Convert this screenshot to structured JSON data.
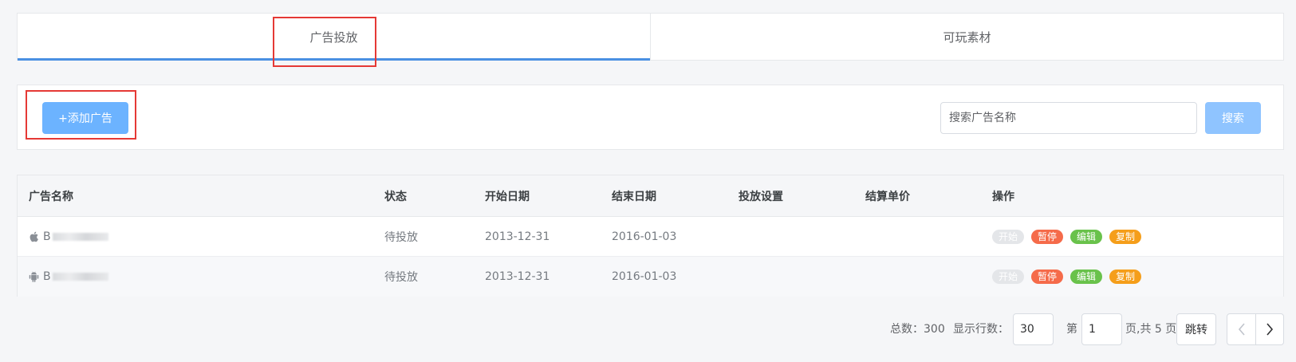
{
  "tabs": [
    {
      "label": "广告投放",
      "active": true
    },
    {
      "label": "可玩素材",
      "active": false
    }
  ],
  "toolbar": {
    "add_label": "+添加广告",
    "search_placeholder": "搜索广告名称",
    "search_label": "搜索"
  },
  "table": {
    "headers": {
      "name": "广告名称",
      "status": "状态",
      "start": "开始日期",
      "end": "结束日期",
      "setting": "投放设置",
      "price": "结算单价",
      "ops": "操作"
    },
    "rows": [
      {
        "platform_icon": "apple-icon",
        "name": "B",
        "status": "待投放",
        "start": "2013-12-31",
        "end": "2016-01-03",
        "setting": "",
        "price": ""
      },
      {
        "platform_icon": "android-icon",
        "name": "B",
        "status": "待投放",
        "start": "2013-12-31",
        "end": "2016-01-03",
        "setting": "",
        "price": ""
      }
    ],
    "actions": {
      "start": "开始",
      "pause": "暂停",
      "edit": "编辑",
      "copy": "复制"
    }
  },
  "pagination": {
    "total_label": "总数：300",
    "rows_label": "显示行数：",
    "rows_value": "30",
    "page_prefix": "第",
    "page_value": "1",
    "page_suffix": "页,共 5 页",
    "jump_label": "跳转",
    "prev_icon": "chevron-left-icon",
    "next_icon": "chevron-right-icon"
  },
  "colors": {
    "accent": "#4a90e2",
    "primary_button": "#6cb3ff",
    "pause": "#f56b4a",
    "edit": "#69c24b",
    "copy": "#f59e1a",
    "highlight": "#e53935"
  }
}
